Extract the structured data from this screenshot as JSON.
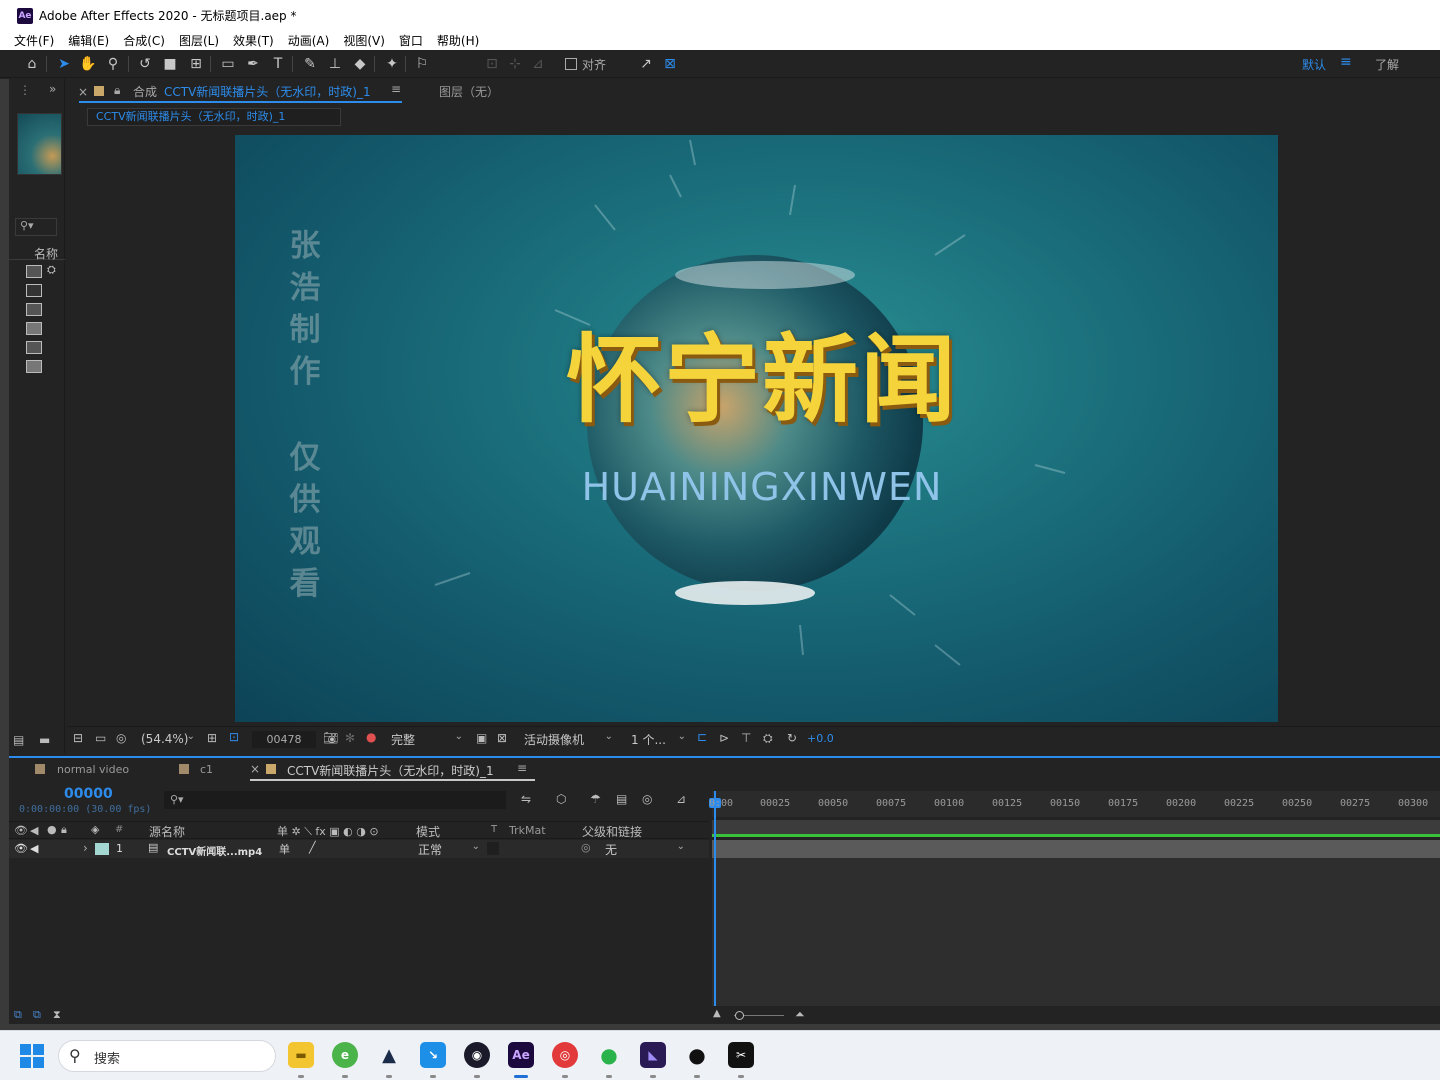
{
  "window": {
    "app_icon": "Ae",
    "title": "Adobe After Effects 2020 - 无标题项目.aep *"
  },
  "menu": [
    "文件(F)",
    "编辑(E)",
    "合成(C)",
    "图层(L)",
    "效果(T)",
    "动画(A)",
    "视图(V)",
    "窗口",
    "帮助(H)"
  ],
  "toolbar": {
    "snap_label": "对齐",
    "workspace": "默认",
    "learn": "了解"
  },
  "viewer": {
    "tab_prefix": "合成",
    "comp_name": "CCTV新闻联播片头（无水印，时政)_1",
    "layer_tab": "图层（无）",
    "sub_tab": "CCTV新闻联播片头（无水印，时政)_1",
    "zoom": "(54.4%)",
    "timecode": "00478",
    "quality": "完整",
    "camera": "活动摄像机",
    "views": "1 个...",
    "exposure": "+0.0"
  },
  "canvas": {
    "title_cn": "怀宁新闻",
    "title_en": "HUAININGXINWEN",
    "watermark_top": [
      "张",
      "浩",
      "制",
      "作"
    ],
    "watermark_bottom": [
      "仅",
      "供",
      "观",
      "看"
    ]
  },
  "project": {
    "name_header": "名称"
  },
  "timeline": {
    "tabs": [
      "normal video",
      "c1",
      "CCTV新闻联播片头（无水印，时政)_1"
    ],
    "current_frame": "00000",
    "timecode_sub": "0:00:00:00 (30.00 fps)",
    "col_source": "源名称",
    "col_mode": "模式",
    "col_t": "T",
    "col_trkmat": "TrkMat",
    "col_parent": "父级和链接",
    "col_num": "#",
    "layer": {
      "index": "1",
      "name": "CCTV新闻联...mp4",
      "mode": "正常",
      "parent": "无"
    },
    "ruler": [
      "0:00",
      "00025",
      "00050",
      "00075",
      "00100",
      "00125",
      "00150",
      "00175",
      "00200",
      "00225",
      "00250",
      "00275",
      "00300"
    ]
  },
  "taskbar": {
    "search_placeholder": "搜索",
    "apps": [
      "start",
      "search",
      "file-explorer",
      "browser",
      "app-cat",
      "app-blue",
      "cinema4d",
      "after-effects",
      "netease-music",
      "wechat",
      "premiere-like",
      "qq",
      "capcut"
    ]
  },
  "colors": {
    "accent": "#2d8ceb",
    "layer_label": "#a4d7d2",
    "title_gold": "#f4d43a"
  }
}
